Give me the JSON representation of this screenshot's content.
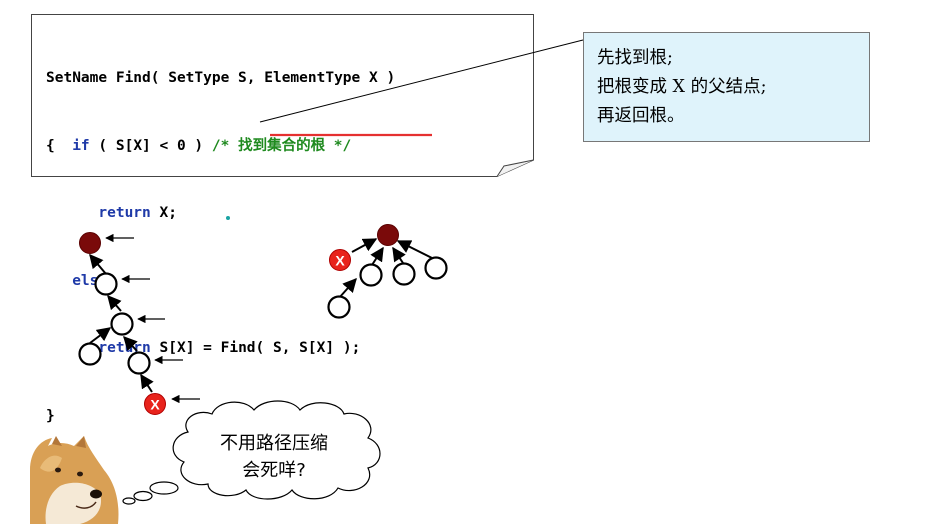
{
  "code": {
    "line1": "SetName Find( SetType S, ElementType X )",
    "line2_open": "{  ",
    "line2_kw": "if",
    "line2_cond": " ( S[X] < 0 ) ",
    "line2_comment": "/* 找到集合的根 */",
    "line3_kw": "return",
    "line3_rest": " X;",
    "line4_kw": "else",
    "line5_kw": "return",
    "line5_rest": " S[X] = Find( S, S[X] );",
    "line6": "}"
  },
  "note": {
    "line1": "先找到根;",
    "line2": "把根变成 X 的父结点;",
    "line3": "再返回根。"
  },
  "cloud": {
    "line1": "不用路径压缩",
    "line2": "会死咩?"
  },
  "node_label": "X",
  "colors": {
    "root": "#7a0a0a",
    "x_node": "#e8231c",
    "underline": "#e53030",
    "note_bg": "#dff3fb",
    "dot": "#1aa3a3"
  }
}
